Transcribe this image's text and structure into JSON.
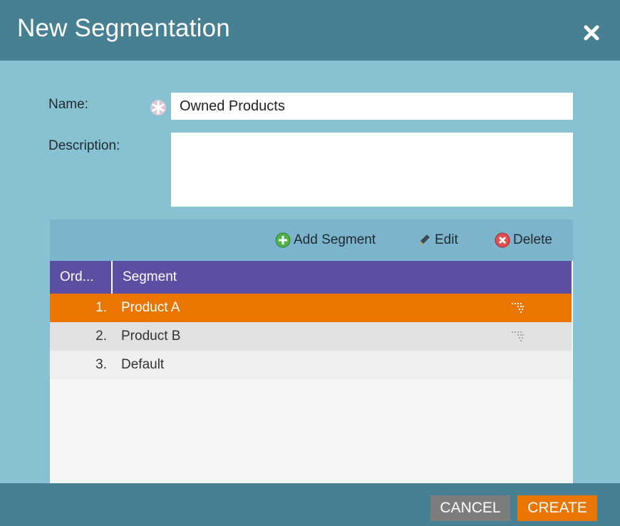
{
  "dialog": {
    "title": "New Segmentation"
  },
  "form": {
    "name_label": "Name:",
    "name_value": "Owned Products",
    "description_label": "Description:",
    "description_value": ""
  },
  "toolbar": {
    "add_label": "Add Segment",
    "edit_label": "Edit",
    "delete_label": "Delete"
  },
  "grid": {
    "columns": [
      "Ord...",
      "Segment"
    ],
    "rows": [
      {
        "order": "1.",
        "segment": "Product A",
        "selected": true
      },
      {
        "order": "2.",
        "segment": "Product B",
        "selected": false
      },
      {
        "order": "3.",
        "segment": "Default",
        "selected": false
      }
    ]
  },
  "footer": {
    "cancel_label": "CANCEL",
    "create_label": "CREATE"
  },
  "colors": {
    "header": "#468092",
    "body": "#88c2d2",
    "grid_header": "#5a4fa3",
    "selected_row": "#ea7600"
  }
}
